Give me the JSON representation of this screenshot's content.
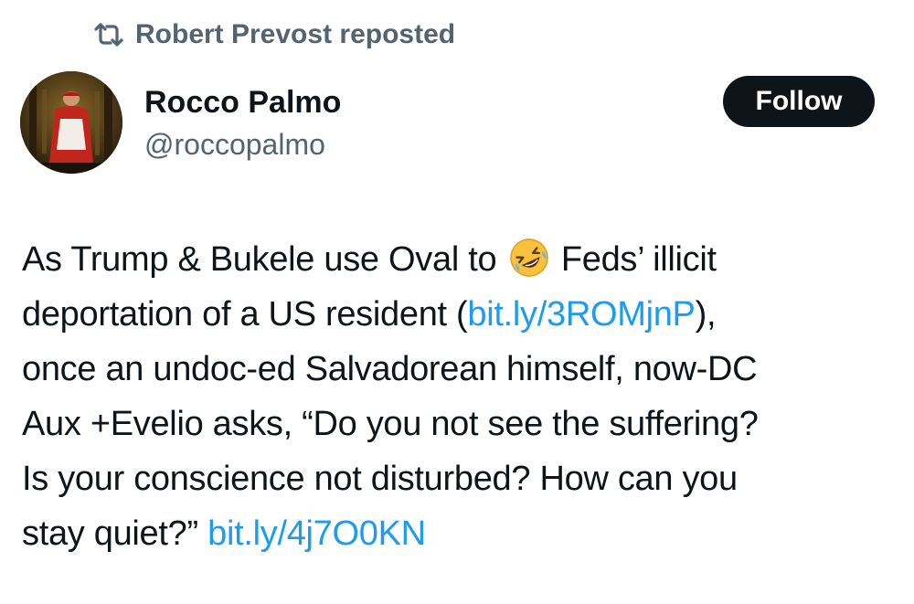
{
  "repost": {
    "label": "Robert Prevost reposted",
    "icon": "repost-icon"
  },
  "author": {
    "display_name": "Rocco Palmo",
    "handle": "@roccopalmo",
    "avatar_icon": "avatar-cardinal-photo"
  },
  "follow_button": {
    "label": "Follow"
  },
  "tweet": {
    "line1_a": "As Trump & Bukele use Oval to",
    "emoji": "rolling-on-floor-laughing-emoji",
    "line1_b": "Feds’ illicit",
    "line2_a": "deportation of a US resident (",
    "link1": "bit.ly/3ROMjnP",
    "line2_b": "),",
    "line3": "once an undoc-ed Salvadorean himself, now-DC",
    "line4": "Aux +Evelio asks, “Do you not see the suffering?",
    "line5": "Is your conscience not disturbed? How can you",
    "line6_a": "stay quiet?” ",
    "link2": "bit.ly/4j7O0KN"
  },
  "colors": {
    "link": "#1d9bf0",
    "secondary_text": "#536471",
    "primary_text": "#0f1419",
    "button_bg": "#0f1419"
  }
}
